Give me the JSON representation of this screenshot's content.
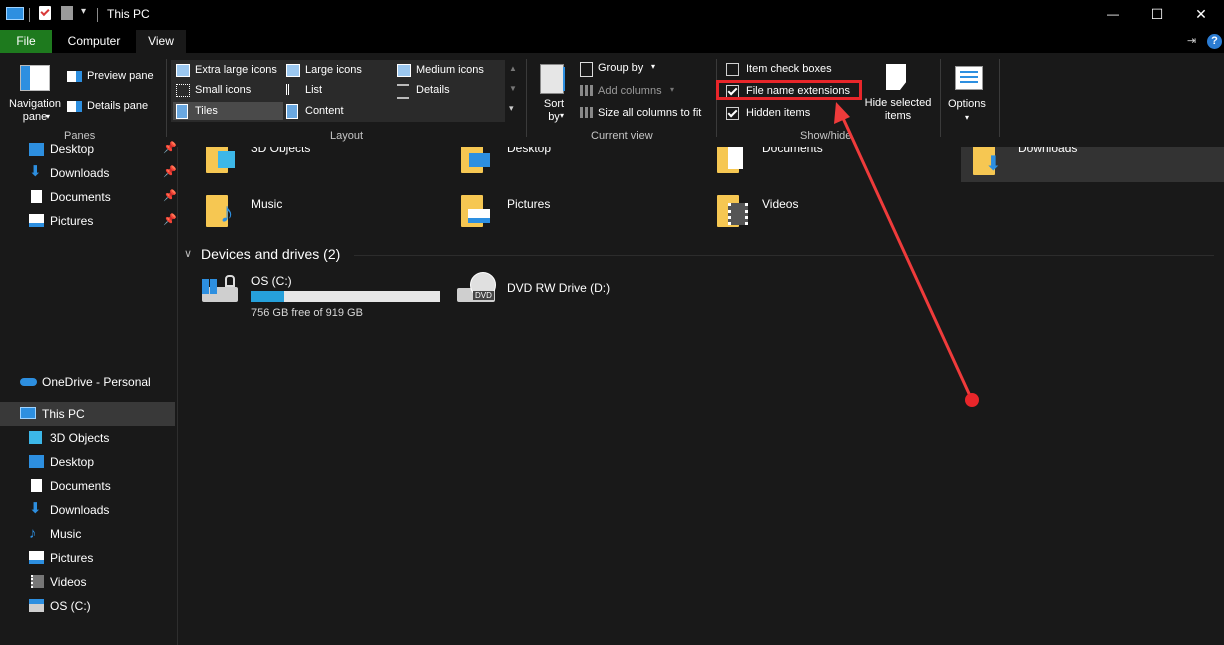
{
  "window": {
    "title": "This PC",
    "controls": {
      "minimize": "—",
      "maximize": "☐",
      "close": "✕"
    },
    "help": "?"
  },
  "tabs": [
    "File",
    "Computer",
    "View"
  ],
  "ribbon": {
    "panes": {
      "navigation_pane": "Navigation pane",
      "preview_pane": "Preview pane",
      "details_pane": "Details pane",
      "group": "Panes"
    },
    "layout": {
      "extra_large_icons": "Extra large icons",
      "large_icons": "Large icons",
      "medium_icons": "Medium icons",
      "small_icons": "Small icons",
      "list": "List",
      "details": "Details",
      "tiles": "Tiles",
      "content": "Content",
      "group": "Layout"
    },
    "current_view": {
      "sort_by": "Sort by",
      "group_by": "Group by",
      "add_columns": "Add columns",
      "size_all_columns": "Size all columns to fit",
      "group": "Current view"
    },
    "show_hide": {
      "item_check_boxes": {
        "label": "Item check boxes",
        "checked": false
      },
      "file_name_extensions": {
        "label": "File name extensions",
        "checked": true
      },
      "hidden_items": {
        "label": "Hidden items",
        "checked": true
      },
      "hide_selected_items": "Hide selected items",
      "group": "Show/hide"
    },
    "options": "Options"
  },
  "nav": {
    "quick_access": [
      "Desktop",
      "Downloads",
      "Documents",
      "Pictures"
    ],
    "onedrive": "OneDrive - Personal",
    "this_pc": "This PC",
    "this_pc_items": [
      "3D Objects",
      "Desktop",
      "Documents",
      "Downloads",
      "Music",
      "Pictures",
      "Videos",
      "OS (C:)"
    ]
  },
  "content": {
    "folders": [
      "3D Objects",
      "Desktop",
      "Documents",
      "Downloads",
      "Music",
      "Pictures",
      "Videos"
    ],
    "devices_header": "Devices and drives (2)",
    "drive_c": {
      "name": "OS (C:)",
      "free": "756 GB free of 919 GB",
      "used_fraction": 0.177
    },
    "drive_d": {
      "name": "DVD RW Drive (D:)",
      "badge": "DVD"
    }
  },
  "colors": {
    "file_tab": "#1e7a1e",
    "highlight_box": "#e8262a",
    "arrow": "#ef3b3b",
    "drive_bar": "#26a0da"
  }
}
